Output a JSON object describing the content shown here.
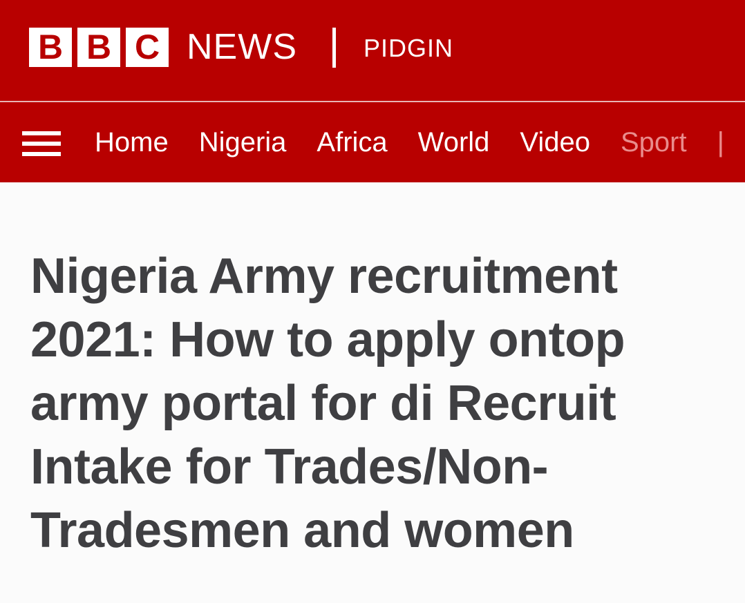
{
  "brand": {
    "logo_letters": [
      "B",
      "B",
      "C"
    ],
    "news_label": "NEWS",
    "service_name": "PIDGIN",
    "colors": {
      "brand_red": "#b80000",
      "headline_text": "#3f3f42",
      "faded_nav": "#e98c8c"
    }
  },
  "nav": {
    "menu_icon": "hamburger-menu-icon",
    "items": [
      {
        "label": "Home"
      },
      {
        "label": "Nigeria"
      },
      {
        "label": "Africa"
      },
      {
        "label": "World"
      },
      {
        "label": "Video"
      },
      {
        "label": "Sport"
      }
    ]
  },
  "article": {
    "headline": "Nigeria Army recruitment 2021: How to apply ontop army portal for di Recruit Intake for Trades/Non-Tradesmen and women"
  }
}
